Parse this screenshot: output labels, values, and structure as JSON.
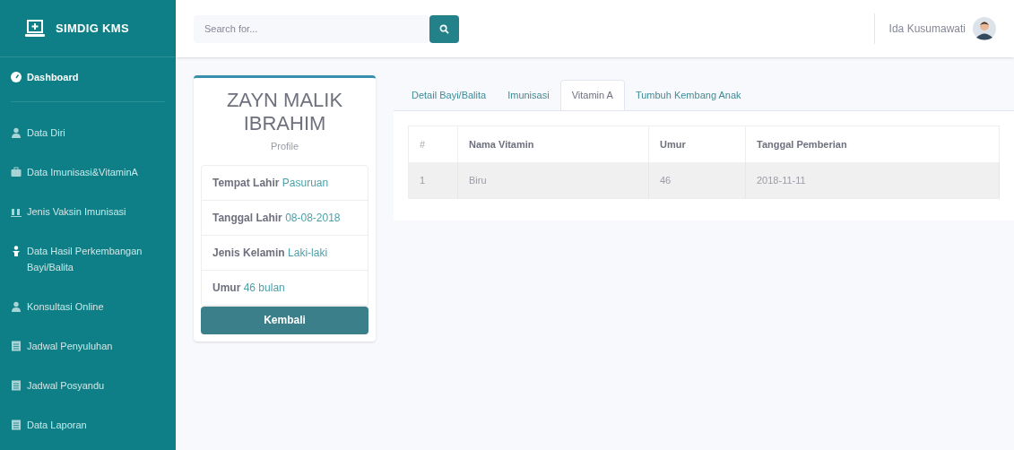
{
  "brand": {
    "title": "SIMDIG KMS"
  },
  "sidebar": {
    "items": [
      {
        "label": "Dashboard",
        "kind": "gauge",
        "selected": true
      },
      {
        "label": "Data Diri",
        "kind": "user",
        "selected": false
      },
      {
        "label": "Data Imunisasi&VitaminA",
        "kind": "briefcase",
        "selected": false
      },
      {
        "label": "Jenis Vaksin Imunisasi",
        "kind": "chart",
        "selected": false
      },
      {
        "label": "Data Hasil Perkembangan Bayi/Balita",
        "kind": "child",
        "selected": false
      },
      {
        "label": "Konsultasi Online",
        "kind": "user",
        "selected": false
      },
      {
        "label": "Jadwal Penyuluhan",
        "kind": "list",
        "selected": false
      },
      {
        "label": "Jadwal Posyandu",
        "kind": "list",
        "selected": false
      },
      {
        "label": "Data Laporan",
        "kind": "list",
        "selected": false
      }
    ]
  },
  "search": {
    "placeholder": "Search for..."
  },
  "user": {
    "name": "Ida Kusumawati"
  },
  "profile": {
    "name": "ZAYN MALIK IBRAHIM",
    "subtitle": "Profile",
    "fields": [
      {
        "label": "Tempat Lahir",
        "value": "Pasuruan"
      },
      {
        "label": "Tanggal Lahir",
        "value": "08-08-2018"
      },
      {
        "label": "Jenis Kelamin",
        "value": "Laki-laki"
      },
      {
        "label": "Umur",
        "value": "46 bulan"
      }
    ],
    "button": "Kembali"
  },
  "tabs": [
    {
      "label": "Detail Bayi/Balita",
      "selected": false
    },
    {
      "label": "Imunisasi",
      "selected": false
    },
    {
      "label": "Vitamin A",
      "selected": true
    },
    {
      "label": "Tumbuh Kembang Anak",
      "selected": false
    }
  ],
  "table": {
    "columns": [
      "#",
      "Nama Vitamin",
      "Umur",
      "Tanggal Pemberian"
    ],
    "rows": [
      [
        "1",
        "Biru",
        "46",
        "2018-11-11"
      ]
    ]
  }
}
